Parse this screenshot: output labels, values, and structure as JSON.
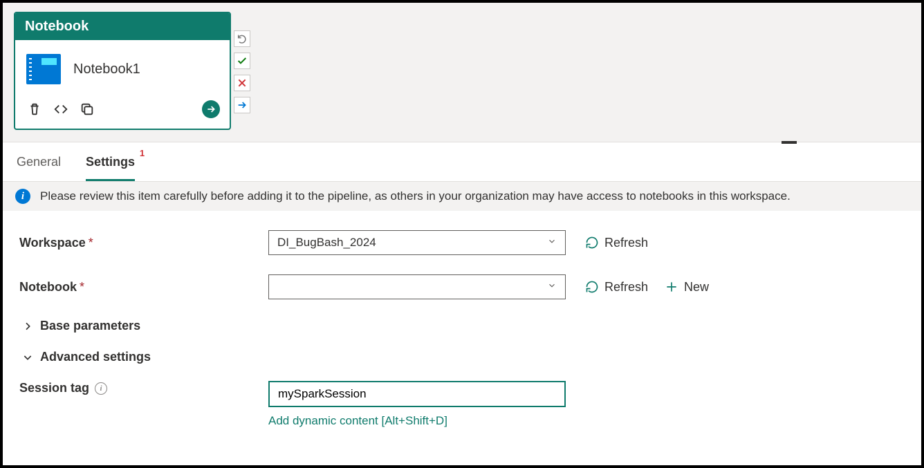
{
  "activity": {
    "header": "Notebook",
    "name": "Notebook1"
  },
  "tabs": {
    "general": "General",
    "settings": "Settings",
    "settings_badge": "1"
  },
  "banner": {
    "text": "Please review this item carefully before adding it to the pipeline, as others in your organization may have access to notebooks in this workspace."
  },
  "form": {
    "workspace_label": "Workspace",
    "workspace_value": "DI_BugBash_2024",
    "notebook_label": "Notebook",
    "notebook_value": "",
    "refresh_label": "Refresh",
    "new_label": "New",
    "base_params_label": "Base parameters",
    "advanced_label": "Advanced settings",
    "session_tag_label": "Session tag",
    "session_tag_value": "mySparkSession",
    "dynamic_link": "Add dynamic content [Alt+Shift+D]"
  },
  "icons": {
    "info_glyph": "i",
    "help_glyph": "i"
  }
}
